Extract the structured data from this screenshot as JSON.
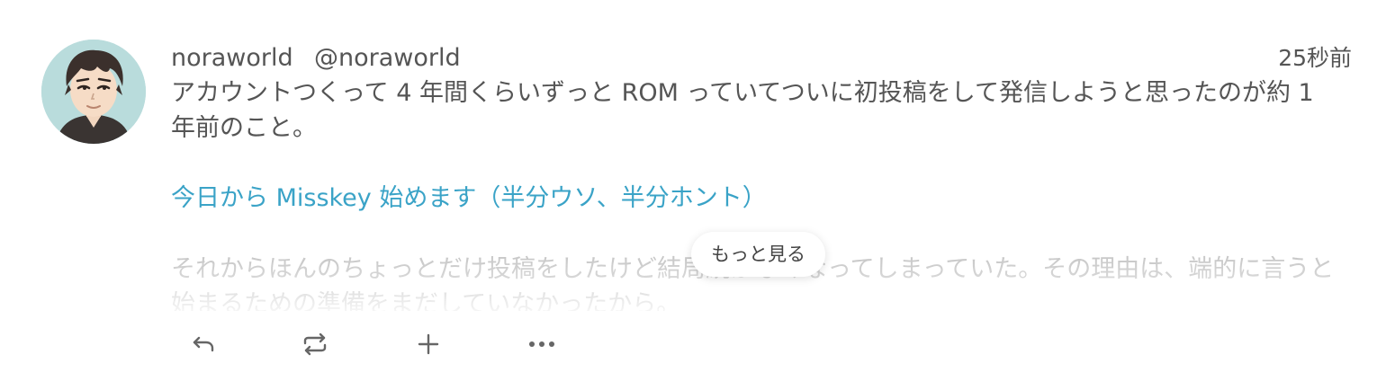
{
  "user": {
    "display_name": "noraworld",
    "username": "@noraworld"
  },
  "note": {
    "timestamp": "25秒前",
    "paragraph_1": "アカウントつくって 4 年間くらいずっと ROM っていてついに初投稿をして発信しようと思ったのが約 1 年前のこと。",
    "link_text": "今日から Misskey 始めます（半分ウソ、半分ホント）",
    "paragraph_2": "それからほんのちょっとだけ投稿をしたけど結局続かなくなってしまっていた。その理由は、端的に言うと始まるための準備をまだしていなかったから。",
    "show_more_label": "もっと見る"
  },
  "actions": {
    "reply_icon": "reply-icon",
    "renote_icon": "renote-icon",
    "reaction_icon": "plus-icon",
    "more_icon": "more-dots-icon"
  },
  "colors": {
    "text": "#555555",
    "link": "#3aa3c7",
    "icon": "#666666"
  }
}
